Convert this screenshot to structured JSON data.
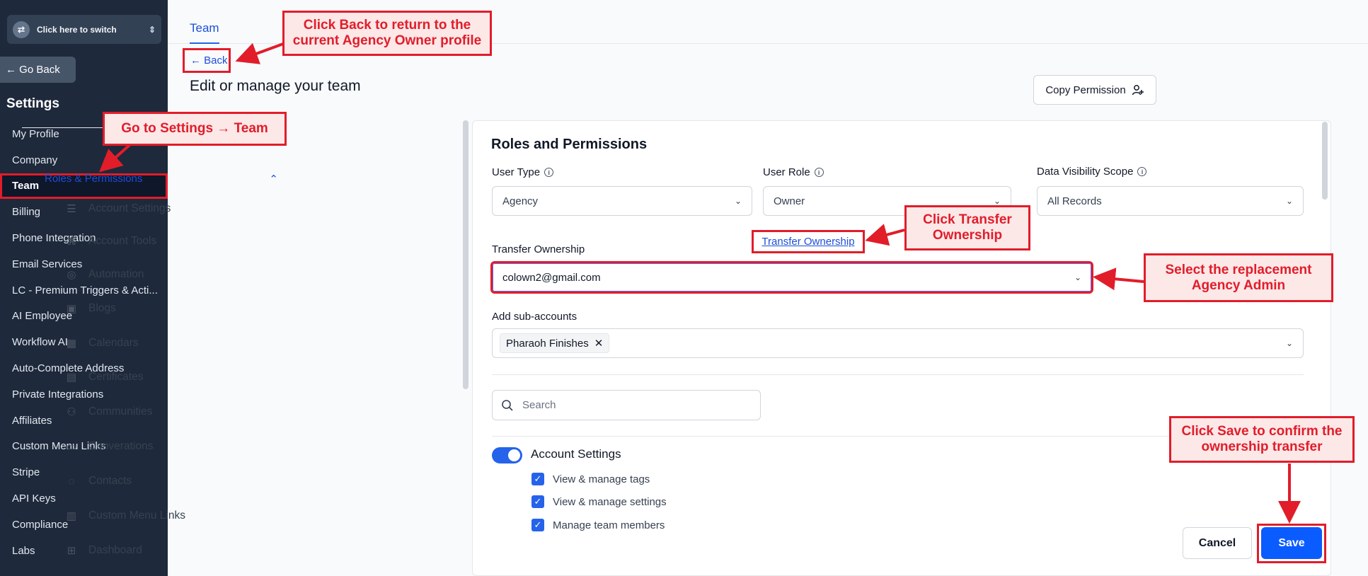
{
  "sidebar": {
    "switcher_label": "Click here to switch",
    "go_back": "← Go Back",
    "settings_title": "Settings",
    "items": [
      {
        "label": "My Profile"
      },
      {
        "label": "Company"
      },
      {
        "label": "Team"
      },
      {
        "label": "Billing"
      },
      {
        "label": "Phone Integration"
      },
      {
        "label": "Email Services"
      },
      {
        "label": "LC - Premium Triggers & Acti..."
      },
      {
        "label": "AI Employee"
      },
      {
        "label": "Workflow AI"
      },
      {
        "label": "Auto-Complete Address"
      },
      {
        "label": "Private Integrations"
      },
      {
        "label": "Affiliates"
      },
      {
        "label": "Custom Menu Links"
      },
      {
        "label": "Stripe"
      },
      {
        "label": "API Keys"
      },
      {
        "label": "Compliance"
      },
      {
        "label": "Labs"
      }
    ],
    "active_item": "Team"
  },
  "header": {
    "tab": "Team",
    "back": "← Back",
    "page_title": "Edit or manage your team",
    "copy_permission": "Copy Permission"
  },
  "submenu": {
    "section": "Roles & Permissions",
    "items": [
      {
        "label": "Account Settings",
        "icon": "toggles-icon"
      },
      {
        "label": "Account Tools",
        "icon": "command-icon"
      },
      {
        "label": "Automation",
        "icon": "target-icon"
      },
      {
        "label": "Blogs",
        "icon": "blog-icon"
      },
      {
        "label": "Calendars",
        "icon": "calendar-icon"
      },
      {
        "label": "Certificates",
        "icon": "certificate-icon"
      },
      {
        "label": "Communities",
        "icon": "people-icon"
      },
      {
        "label": "Converations",
        "icon": "inbox-icon"
      },
      {
        "label": "Contacts",
        "icon": "chat-icon"
      },
      {
        "label": "Custom Menu Links",
        "icon": "list-icon"
      },
      {
        "label": "Dashboard",
        "icon": "grid-icon"
      }
    ]
  },
  "panel": {
    "title": "Roles and Permissions",
    "user_type_label": "User Type",
    "user_type_value": "Agency",
    "user_role_label": "User Role",
    "user_role_value": "Owner",
    "scope_label": "Data Visibility Scope",
    "scope_value": "All Records",
    "transfer_label": "Transfer Ownership",
    "transfer_link": "Transfer Ownership",
    "transfer_value": "colown2@gmail.com",
    "subaccounts_label": "Add sub-accounts",
    "subaccount_chip": "Pharaoh Finishes",
    "search_placeholder": "Search",
    "toggle_label": "Account Settings",
    "permissions": [
      {
        "label": "View & manage tags"
      },
      {
        "label": "View & manage settings"
      },
      {
        "label": "Manage team members"
      }
    ],
    "cancel": "Cancel",
    "save": "Save"
  },
  "callouts": {
    "back": "Click Back to return to the current Agency Owner profile",
    "settings": "Go to Settings → Team",
    "transfer": "Click Transfer Ownership",
    "select": "Select the replacement Agency Admin",
    "save": "Click Save to confirm the ownership transfer"
  },
  "colors": {
    "accent": "#2563eb",
    "callout_red": "#e11d2a",
    "sidebar_bg": "#1e293b"
  }
}
